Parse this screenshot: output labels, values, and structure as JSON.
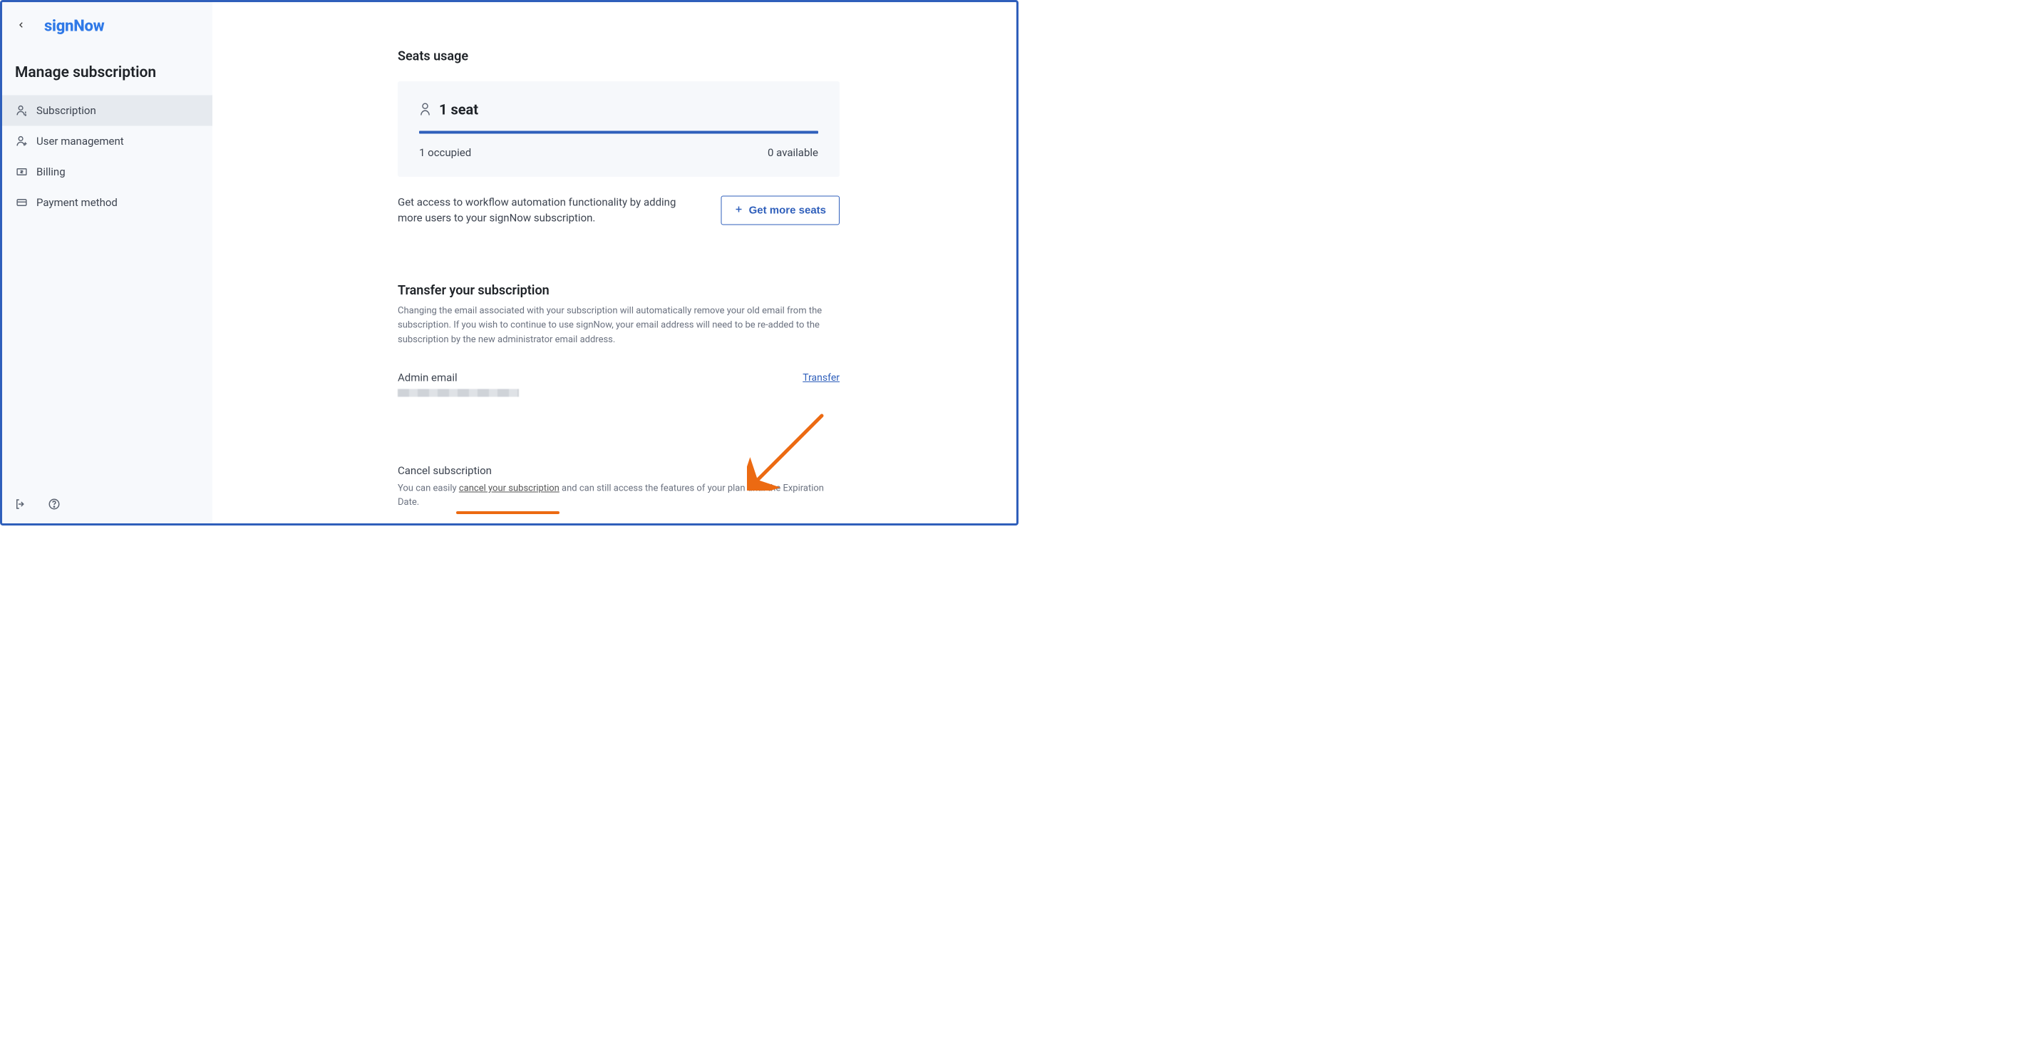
{
  "brand": {
    "logo_text": "signNow"
  },
  "page": {
    "title": "Manage subscription"
  },
  "sidebar": {
    "items": [
      {
        "label": "Subscription",
        "icon": "person-info-icon",
        "active": true
      },
      {
        "label": "User management",
        "icon": "person-plus-icon",
        "active": false
      },
      {
        "label": "Billing",
        "icon": "money-icon",
        "active": false
      },
      {
        "label": "Payment method",
        "icon": "card-icon",
        "active": false
      }
    ]
  },
  "seats": {
    "section_title": "Seats usage",
    "count_label": "1 seat",
    "occupied_label": "1 occupied",
    "available_label": "0 available",
    "below_text": "Get access to workflow automation functionality by adding more users to your signNow subscription.",
    "get_more_label": "Get more seats"
  },
  "transfer": {
    "title": "Transfer your subscription",
    "description": "Changing the email associated with your subscription will automatically remove your old email from the subscription. If you wish to continue to use signNow, your email address will need to be re-added to the subscription by the new administrator email address.",
    "admin_label": "Admin email",
    "transfer_link_label": "Transfer"
  },
  "cancel": {
    "title": "Cancel subscription",
    "text_prefix": "You can easily ",
    "link_label": "cancel your subscription",
    "text_suffix": " and can still access the features of your plan until the Expiration Date."
  },
  "colors": {
    "accent": "#2f5fbb",
    "annotation": "#ec6a12"
  }
}
